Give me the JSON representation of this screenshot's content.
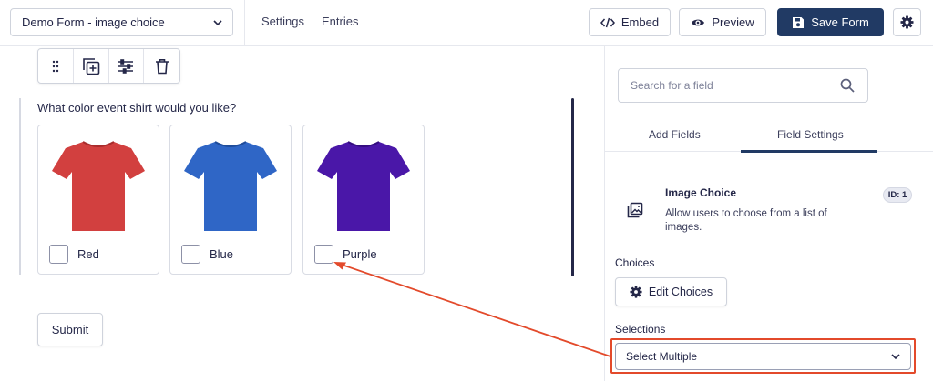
{
  "header": {
    "form_selector": {
      "value": "Demo Form - image choice",
      "icon": "chevron-down-icon"
    },
    "nav": [
      {
        "label": "Settings"
      },
      {
        "label": "Entries"
      }
    ],
    "embed": {
      "label": "Embed",
      "icon": "code-icon"
    },
    "preview": {
      "label": "Preview",
      "icon": "eye-icon"
    },
    "save": {
      "label": "Save Form",
      "icon": "floppy-disk-icon"
    },
    "settings_icon": "gear-icon"
  },
  "field_toolbar": {
    "icons": [
      "drag-handle-icon",
      "duplicate-icon",
      "settings-sliders-icon",
      "trash-icon"
    ]
  },
  "field": {
    "question": "What color event shirt would you like?",
    "choices": [
      {
        "label": "Red",
        "color": "#d2403f",
        "checked": false
      },
      {
        "label": "Blue",
        "color": "#2f66c6",
        "checked": false
      },
      {
        "label": "Purple",
        "color": "#4a17a8",
        "checked": false
      }
    ]
  },
  "submit": {
    "label": "Submit"
  },
  "sidebar": {
    "search": {
      "placeholder": "Search for a field",
      "value": "",
      "icon": "search-icon"
    },
    "tabs": [
      {
        "label": "Add Fields",
        "active": false
      },
      {
        "label": "Field Settings",
        "active": true
      }
    ],
    "field_settings": {
      "icon": "image-icon",
      "title": "Image Choice",
      "description": "Allow users to choose from a list of images.",
      "id_badge": "ID: 1"
    },
    "choices": {
      "label": "Choices",
      "button_label": "Edit Choices",
      "button_icon": "gear-icon"
    },
    "selections": {
      "label": "Selections",
      "value": "Select Multiple",
      "icon": "chevron-down-icon"
    }
  },
  "colors": {
    "brand_navy": "#213a64",
    "annotation": "#e34a2b",
    "text": "#242748"
  }
}
